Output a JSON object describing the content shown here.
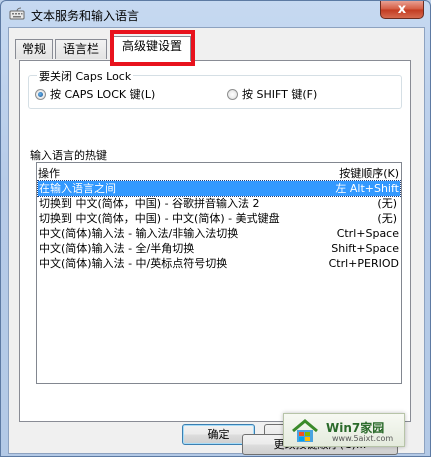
{
  "window": {
    "title": "文本服务和输入语言",
    "close_label": "x",
    "icon": "keyboard-icon"
  },
  "tabs": [
    {
      "label": "常规",
      "active": false
    },
    {
      "label": "语言栏",
      "active": false
    },
    {
      "label": "高级键设置",
      "active": true
    }
  ],
  "caps_lock": {
    "group_label": "要关闭 Caps Lock",
    "options": [
      {
        "label": "按 CAPS LOCK 键(L)",
        "checked": true
      },
      {
        "label": "按 SHIFT 键(F)",
        "checked": false
      }
    ]
  },
  "hotkeys": {
    "group_label": "输入语言的热键",
    "columns": [
      "操作",
      "按键顺序(K)"
    ],
    "rows": [
      {
        "action": "在输入语言之间",
        "keys": "左 Alt+Shift",
        "selected": true
      },
      {
        "action": "切换到 中文(简体，中国) - 谷歌拼音输入法 2",
        "keys": "(无)",
        "selected": false
      },
      {
        "action": "切换到 中文(简体，中国) - 中文(简体) - 美式键盘",
        "keys": "(无)",
        "selected": false
      },
      {
        "action": "中文(简体)输入法 - 输入法/非输入法切换",
        "keys": "Ctrl+Space",
        "selected": false
      },
      {
        "action": "中文(简体)输入法 - 全/半角切换",
        "keys": "Shift+Space",
        "selected": false
      },
      {
        "action": "中文(简体)输入法 - 中/英标点符号切换",
        "keys": "Ctrl+PERIOD",
        "selected": false
      }
    ],
    "change_button": "更改按键顺序(C)..."
  },
  "footer": {
    "ok_button": "确定"
  },
  "watermark": {
    "title": "Win7家园",
    "url": "www.5aixt.com",
    "icon": "house-logo-icon"
  },
  "colors": {
    "highlight_box": "#e8121d",
    "selection": "#3399ff"
  }
}
